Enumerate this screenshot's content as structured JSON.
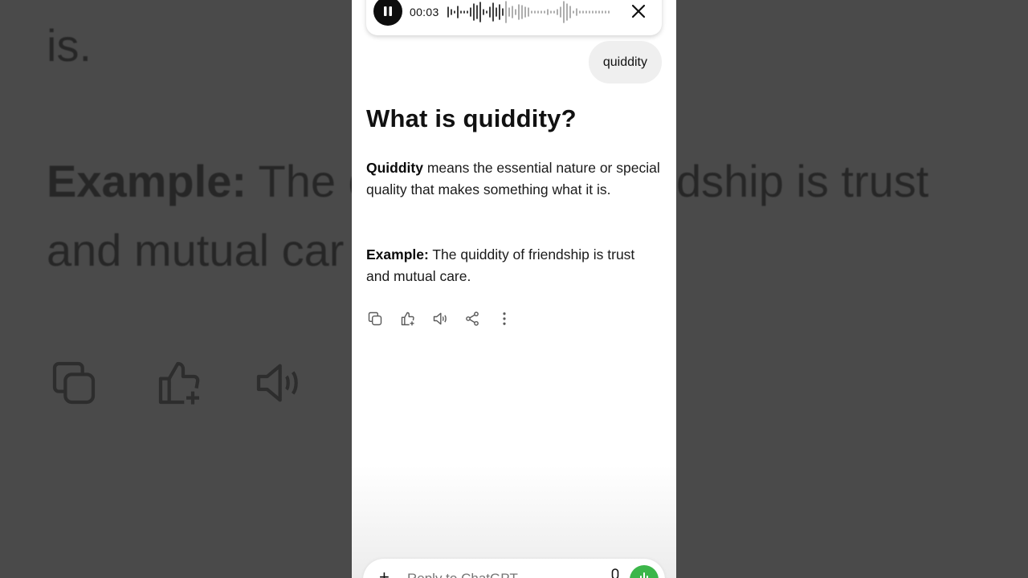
{
  "background": {
    "line1": "is.",
    "example_label": "Example:",
    "example_text_a": "The q",
    "example_text_b": "dship is trust",
    "line3": "and mutual car"
  },
  "recording": {
    "time": "00:03",
    "pause_icon": "pause-icon",
    "close_icon": "close-icon"
  },
  "user_message": "quiddity",
  "answer": {
    "title": "What is quiddity?",
    "definition_term": "Quiddity",
    "definition_text": " means the essential nature or special quality that makes something what it is.",
    "example_label": "Example:",
    "example_text": " The quiddity of friendship is trust and mutual care."
  },
  "actions": [
    "copy-icon",
    "thumbs-up-icon",
    "speaker-icon",
    "share-icon",
    "more-icon"
  ],
  "composer": {
    "placeholder": "Reply to ChatGPT",
    "plus_label": "+"
  },
  "colors": {
    "voice_button": "#3cb64a",
    "background_dim": "#4a4a4a"
  }
}
